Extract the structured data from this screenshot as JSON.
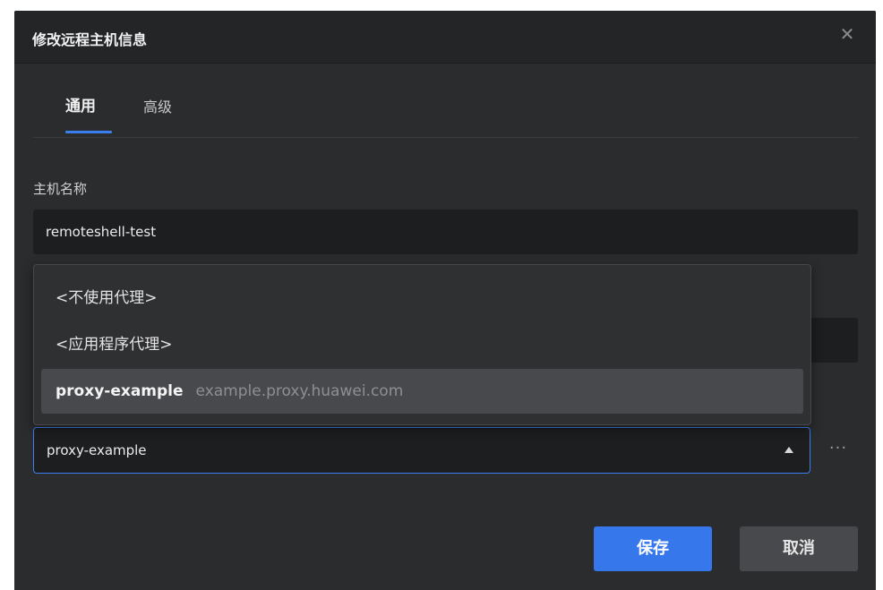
{
  "dialog": {
    "title": "修改远程主机信息",
    "close_icon": "close-icon"
  },
  "tabs": [
    {
      "label": "通用",
      "active": true
    },
    {
      "label": "高级",
      "active": false
    }
  ],
  "host": {
    "label": "主机名称",
    "value": "remoteshell-test"
  },
  "proxy": {
    "options": [
      {
        "label": "<不使用代理>"
      },
      {
        "label": "<应用程序代理>"
      },
      {
        "name": "proxy-example",
        "host": "example.proxy.huawei.com",
        "highlighted": true
      }
    ],
    "selected": "proxy-example",
    "more_label": "···"
  },
  "footer": {
    "save_label": "保存",
    "cancel_label": "取消"
  },
  "colors": {
    "dialog_bg": "#2b2c2e",
    "accent": "#3677ec",
    "input_bg": "#1d1e20"
  }
}
